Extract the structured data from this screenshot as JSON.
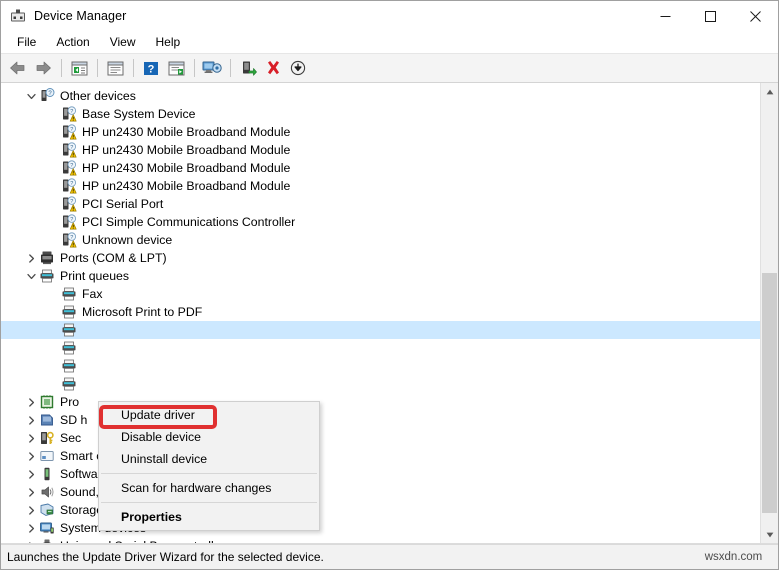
{
  "window": {
    "title": "Device Manager",
    "icon": "device-manager-icon",
    "controls": {
      "minimize": "─",
      "maximize": "□",
      "close": "✕"
    }
  },
  "menubar": {
    "items": [
      {
        "label": "File",
        "name": "menu-file"
      },
      {
        "label": "Action",
        "name": "menu-action"
      },
      {
        "label": "View",
        "name": "menu-view"
      },
      {
        "label": "Help",
        "name": "menu-help"
      }
    ]
  },
  "toolbar": {
    "buttons": [
      {
        "name": "back-icon",
        "title": "Back"
      },
      {
        "name": "forward-icon",
        "title": "Forward"
      },
      {
        "name": "show-hide-console-tree-icon",
        "title": "Show/Hide Console Tree"
      },
      {
        "name": "properties-icon",
        "title": "Properties"
      },
      {
        "name": "help-icon",
        "title": "Help"
      },
      {
        "name": "update-driver-icon",
        "title": "Update driver"
      },
      {
        "name": "scan-for-hardware-changes-icon",
        "title": "Scan for hardware changes"
      },
      {
        "name": "enable-device-icon",
        "title": "Enable device"
      },
      {
        "name": "uninstall-device-icon",
        "title": "Uninstall device"
      },
      {
        "name": "disable-device-icon",
        "title": "Disable device"
      }
    ]
  },
  "tree": {
    "rows": [
      {
        "label": "Other devices",
        "depth": 0,
        "expander": "expanded",
        "icon": "unknown-device-icon",
        "selected": false
      },
      {
        "label": "Base System Device",
        "depth": 1,
        "expander": "none",
        "icon": "warning-device-icon",
        "selected": false
      },
      {
        "label": "HP un2430 Mobile Broadband Module",
        "depth": 1,
        "expander": "none",
        "icon": "warning-device-icon",
        "selected": false
      },
      {
        "label": "HP un2430 Mobile Broadband Module",
        "depth": 1,
        "expander": "none",
        "icon": "warning-device-icon",
        "selected": false
      },
      {
        "label": "HP un2430 Mobile Broadband Module",
        "depth": 1,
        "expander": "none",
        "icon": "warning-device-icon",
        "selected": false
      },
      {
        "label": "HP un2430 Mobile Broadband Module",
        "depth": 1,
        "expander": "none",
        "icon": "warning-device-icon",
        "selected": false
      },
      {
        "label": "PCI Serial Port",
        "depth": 1,
        "expander": "none",
        "icon": "warning-device-icon",
        "selected": false
      },
      {
        "label": "PCI Simple Communications Controller",
        "depth": 1,
        "expander": "none",
        "icon": "warning-device-icon",
        "selected": false
      },
      {
        "label": "Unknown device",
        "depth": 1,
        "expander": "none",
        "icon": "warning-device-icon",
        "selected": false
      },
      {
        "label": "Ports (COM & LPT)",
        "depth": 0,
        "expander": "collapsed",
        "icon": "port-icon",
        "selected": false
      },
      {
        "label": "Print queues",
        "depth": 0,
        "expander": "expanded",
        "icon": "printer-icon",
        "selected": false
      },
      {
        "label": "Fax",
        "depth": 1,
        "expander": "none",
        "icon": "printer-icon",
        "selected": false
      },
      {
        "label": "Microsoft Print to PDF",
        "depth": 1,
        "expander": "none",
        "icon": "printer-icon",
        "selected": false
      },
      {
        "label": "",
        "depth": 1,
        "expander": "none",
        "icon": "printer-icon",
        "selected": true
      },
      {
        "label": "",
        "depth": 1,
        "expander": "none",
        "icon": "printer-icon",
        "selected": false
      },
      {
        "label": "",
        "depth": 1,
        "expander": "none",
        "icon": "printer-icon",
        "selected": false
      },
      {
        "label": "",
        "depth": 1,
        "expander": "none",
        "icon": "printer-icon",
        "selected": false
      },
      {
        "label": "Pro",
        "depth": 0,
        "expander": "collapsed",
        "icon": "processor-icon",
        "selected": false
      },
      {
        "label": "SD h",
        "depth": 0,
        "expander": "collapsed",
        "icon": "sd-host-icon",
        "selected": false
      },
      {
        "label": "Sec",
        "depth": 0,
        "expander": "collapsed",
        "icon": "security-device-icon",
        "selected": false
      },
      {
        "label": "Smart card readers",
        "depth": 0,
        "expander": "collapsed",
        "icon": "smartcard-icon",
        "selected": false
      },
      {
        "label": "Software devices",
        "depth": 0,
        "expander": "collapsed",
        "icon": "software-device-icon",
        "selected": false
      },
      {
        "label": "Sound, video and game controllers",
        "depth": 0,
        "expander": "collapsed",
        "icon": "speaker-icon",
        "selected": false
      },
      {
        "label": "Storage controllers",
        "depth": 0,
        "expander": "collapsed",
        "icon": "storage-icon",
        "selected": false
      },
      {
        "label": "System devices",
        "depth": 0,
        "expander": "collapsed",
        "icon": "system-device-icon",
        "selected": false
      },
      {
        "label": "Universal Serial Bus controllers",
        "depth": 0,
        "expander": "collapsed",
        "icon": "usb-icon",
        "selected": false
      }
    ]
  },
  "context_menu": {
    "items": [
      {
        "label": "Update driver",
        "bold": false,
        "separator_after": false,
        "highlighted": true
      },
      {
        "label": "Disable device",
        "bold": false,
        "separator_after": false,
        "highlighted": false
      },
      {
        "label": "Uninstall device",
        "bold": false,
        "separator_after": true,
        "highlighted": false
      },
      {
        "label": "Scan for hardware changes",
        "bold": false,
        "separator_after": true,
        "highlighted": false
      },
      {
        "label": "Properties",
        "bold": true,
        "separator_after": false,
        "highlighted": false
      }
    ],
    "highlight_color": "#e03030"
  },
  "statusbar": {
    "text": "Launches the Update Driver Wizard for the selected device.",
    "watermark": "wsxdn.com"
  },
  "scrollbar": {
    "up_arrow": "▲",
    "down_arrow": "▼"
  }
}
